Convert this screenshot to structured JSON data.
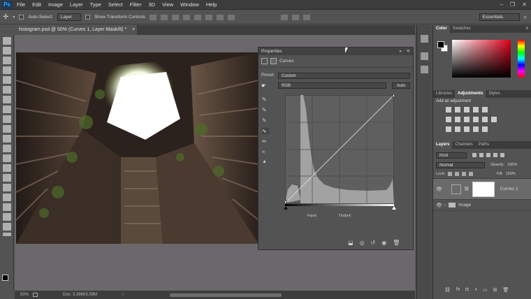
{
  "menubar": {
    "logo": "Ps",
    "items": [
      "File",
      "Edit",
      "Image",
      "Layer",
      "Type",
      "Select",
      "Filter",
      "3D",
      "View",
      "Window",
      "Help"
    ],
    "window_controls": [
      "–",
      "❐",
      "✕"
    ]
  },
  "options_bar": {
    "auto_select_label": "Auto-Select:",
    "auto_select_value": "Layer",
    "show_transform_label": "Show Transform Controls",
    "workspace": "Essentials"
  },
  "document": {
    "tab_title": "histogram.psd @ 50% (Curves 1, Layer Mask/8) *",
    "close": "×"
  },
  "statusbar": {
    "zoom": "50%",
    "doc_info": "Doc: 3.39M/3.39M"
  },
  "properties": {
    "title": "Properties",
    "type_label": "Curves",
    "preset_label": "Preset:",
    "preset_value": "Custom",
    "channel_value": "RGB",
    "auto_button": "Auto",
    "input_label": "Input:",
    "output_label": "Output:"
  },
  "color_panel": {
    "tabs": [
      "Color",
      "Swatches"
    ]
  },
  "adjustments_panel": {
    "tabs": [
      "Libraries",
      "Adjustments",
      "Styles"
    ],
    "heading": "Add an adjustment"
  },
  "layers_panel": {
    "tabs": [
      "Layers",
      "Channels",
      "Paths"
    ],
    "kind_value": "Kind",
    "blend_mode": "Normal",
    "opacity_label": "Opacity:",
    "opacity_value": "100%",
    "lock_label": "Lock:",
    "fill_label": "Fill:",
    "fill_value": "100%",
    "layers": [
      {
        "name": "Curves 1"
      },
      {
        "name": "Image"
      }
    ]
  },
  "colors": {
    "accent": "#31a8ff",
    "panel": "#535353",
    "dark": "#3c3c3c"
  }
}
